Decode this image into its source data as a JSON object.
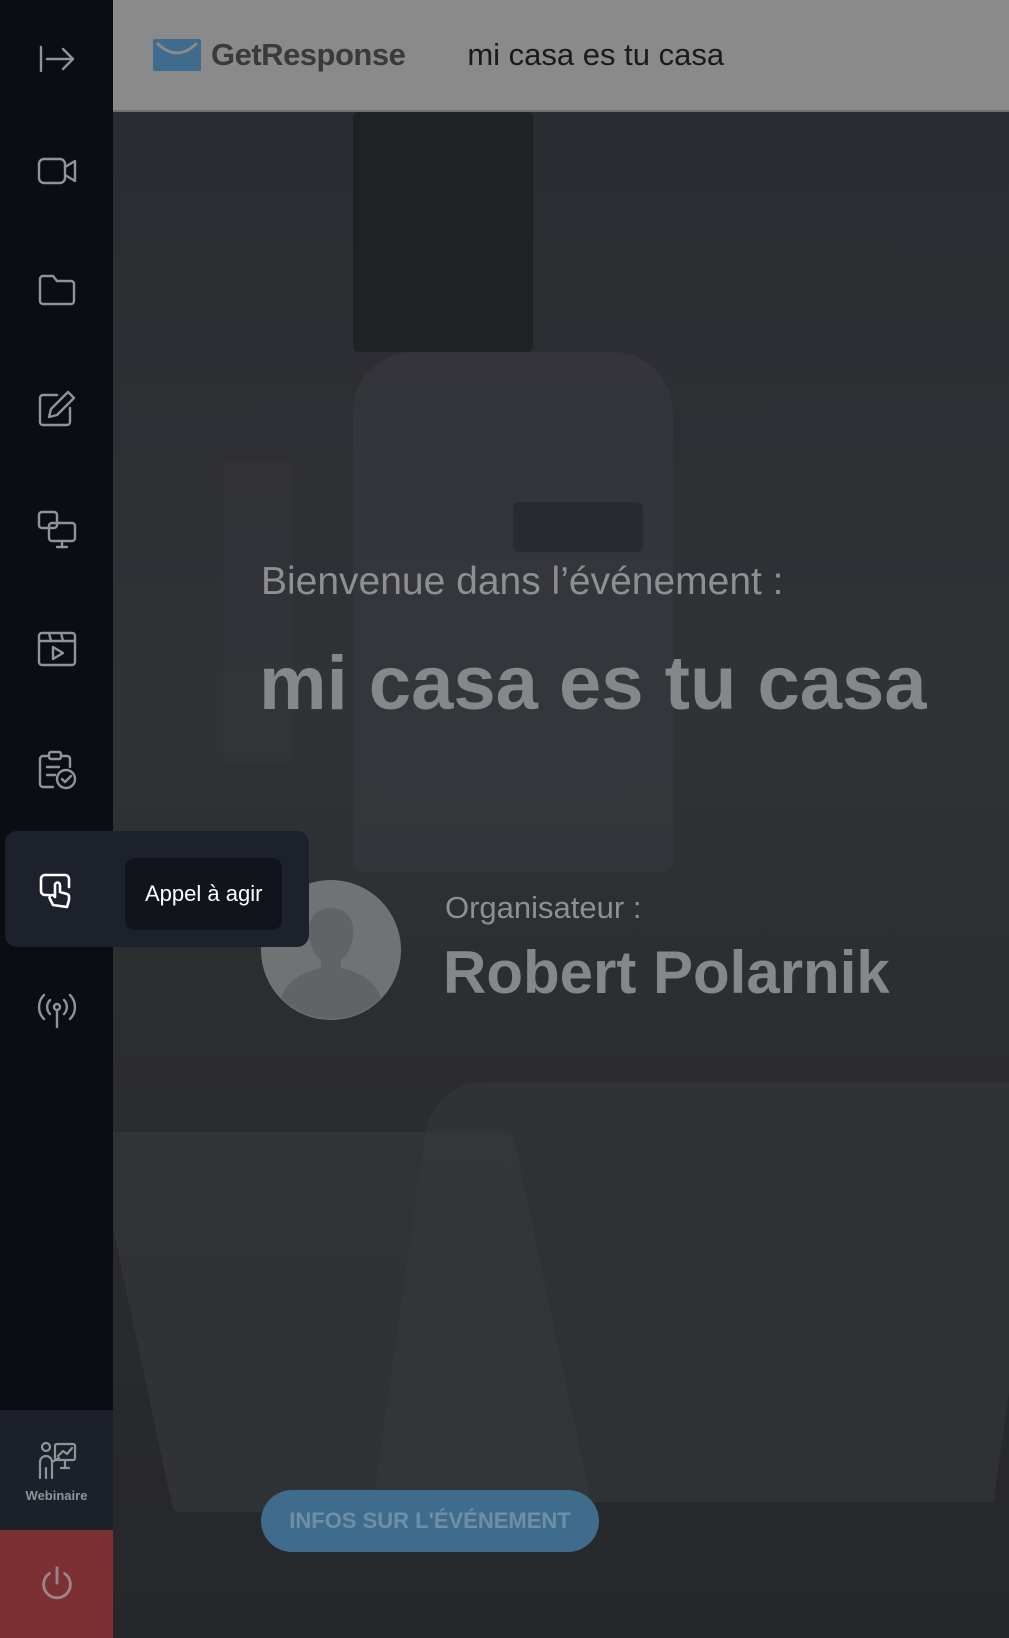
{
  "header": {
    "brand": "GetResponse",
    "event_title": "mi casa es tu casa"
  },
  "sidebar": {
    "items": [
      {
        "icon": "collapse-arrow-icon"
      },
      {
        "icon": "video-camera-icon"
      },
      {
        "icon": "folder-icon"
      },
      {
        "icon": "edit-note-icon"
      },
      {
        "icon": "screen-share-icon"
      },
      {
        "icon": "media-player-icon"
      },
      {
        "icon": "clipboard-check-icon"
      },
      {
        "icon": "call-to-action-icon",
        "active": true,
        "tooltip": "Appel à agir"
      },
      {
        "icon": "broadcast-icon"
      }
    ],
    "webinar_label": "Webinaire",
    "power_icon": "power-icon"
  },
  "main": {
    "welcome": "Bienvenue dans l’événement :",
    "event_title": "mi casa es tu casa",
    "organizer_label": "Organisateur :",
    "organizer_name": "Robert Polarnik",
    "info_button": "INFOS SUR L'ÉVÉNEMENT"
  },
  "colors": {
    "brand_blue": "#3f6c8c",
    "sidebar_bg": "#0b0d12",
    "power_red": "#7b3034"
  }
}
